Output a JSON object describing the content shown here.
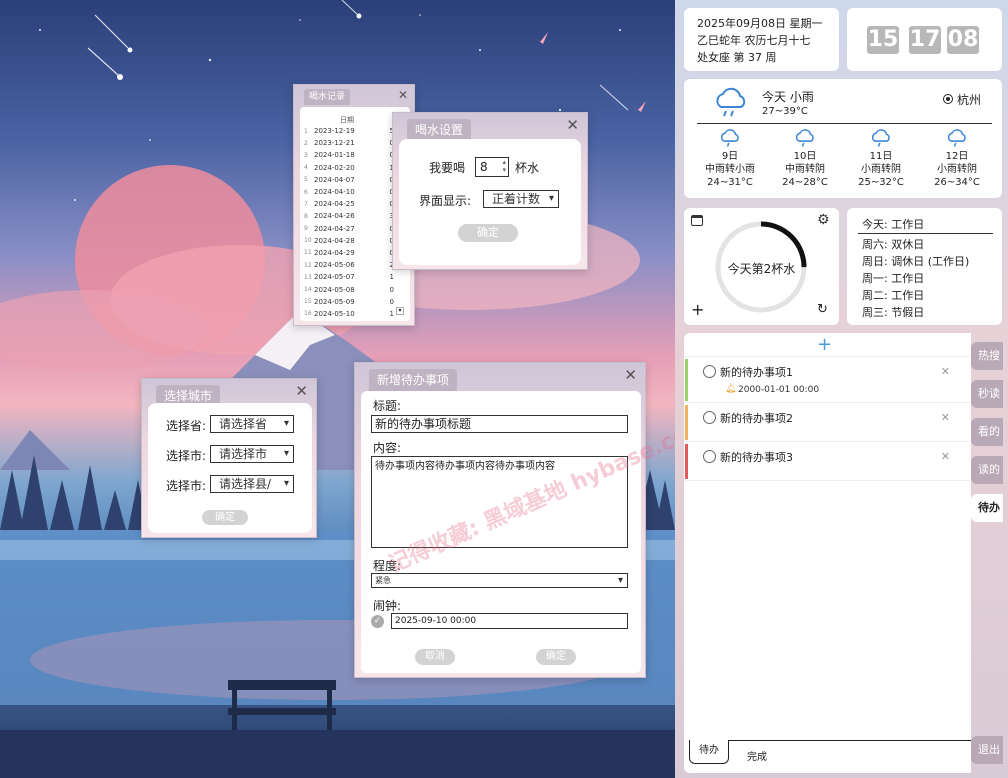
{
  "colors": {
    "accent_green": "#9bd06b",
    "accent_orange": "#f2b266",
    "accent_red": "#e05a5a",
    "plus_blue": "#3d9be9",
    "title_tab": "#bfb2c2"
  },
  "water_record": {
    "title": "喝水记录",
    "header": "日期",
    "rows": [
      {
        "idx": "1",
        "date": "2023-12-19",
        "val": "5"
      },
      {
        "idx": "2",
        "date": "2023-12-21",
        "val": "0"
      },
      {
        "idx": "3",
        "date": "2024-01-18",
        "val": "0"
      },
      {
        "idx": "4",
        "date": "2024-02-20",
        "val": "1"
      },
      {
        "idx": "5",
        "date": "2024-04-07",
        "val": "0"
      },
      {
        "idx": "6",
        "date": "2024-04-10",
        "val": "0"
      },
      {
        "idx": "7",
        "date": "2024-04-25",
        "val": "0"
      },
      {
        "idx": "8",
        "date": "2024-04-26",
        "val": "3"
      },
      {
        "idx": "9",
        "date": "2024-04-27",
        "val": "0"
      },
      {
        "idx": "10",
        "date": "2024-04-28",
        "val": "0"
      },
      {
        "idx": "11",
        "date": "2024-04-29",
        "val": "0"
      },
      {
        "idx": "12",
        "date": "2024-05-06",
        "val": "2"
      },
      {
        "idx": "13",
        "date": "2024-05-07",
        "val": "1"
      },
      {
        "idx": "14",
        "date": "2024-05-08",
        "val": "0"
      },
      {
        "idx": "15",
        "date": "2024-05-09",
        "val": "0"
      },
      {
        "idx": "16",
        "date": "2024-05-10",
        "val": "1"
      }
    ]
  },
  "water_settings": {
    "title": "喝水设置",
    "want_label": "我要喝",
    "cups_value": "8",
    "cups_unit": "杯水",
    "display_label": "界面显示:",
    "display_value": "正着计数",
    "ok": "确定"
  },
  "city": {
    "title": "选择城市",
    "province_label": "选择省:",
    "province_value": "请选择省",
    "city_label": "选择市:",
    "city_value": "请选择市",
    "county_label": "选择市:",
    "county_value": "请选择县/",
    "ok": "确定"
  },
  "new_todo": {
    "title": "新增待办事项",
    "title_label": "标题:",
    "title_value": "新的待办事项标题",
    "content_label": "内容:",
    "content_value": "待办事项内容待办事项内容待办事项内容",
    "level_label": "程度:",
    "level_value": "紧急",
    "alarm_label": "闹钟:",
    "alarm_value": "2025-09-10 00:00",
    "cancel": "取消",
    "ok": "确定"
  },
  "date_card": {
    "line1": "2025年09月08日  星期一",
    "line2": "乙巳蛇年  农历七月十七",
    "line3": "处女座  第 37 周"
  },
  "clock": {
    "h": "15",
    "m": "17",
    "s": "08"
  },
  "weather": {
    "today": "今天 小雨",
    "today_temp": "27~39°C",
    "city": "杭州",
    "forecast": [
      {
        "day": "9日",
        "desc": "中雨转小雨",
        "temp": "24~31°C"
      },
      {
        "day": "10日",
        "desc": "中雨转阴",
        "temp": "24~28°C"
      },
      {
        "day": "11日",
        "desc": "小雨转阴",
        "temp": "25~32°C"
      },
      {
        "day": "12日",
        "desc": "小雨转阴",
        "temp": "26~34°C"
      }
    ]
  },
  "water_widget": {
    "text": "今天第2杯水",
    "progress": 0.25
  },
  "workday": {
    "today": "今天:  工作日",
    "days": [
      "周六:  双休日",
      "周日:  调休日  (工作日)",
      "周一:  工作日",
      "周二:  工作日",
      "周三:  节假日"
    ]
  },
  "todos": [
    {
      "text": "新的待办事项1",
      "alarm": "2000-01-01 00:00"
    },
    {
      "text": "新的待办事项2"
    },
    {
      "text": "新的待办事项3"
    }
  ],
  "side_tabs": [
    "热搜",
    "秒读",
    "看的",
    "读的",
    "待办",
    "退出"
  ],
  "bottom_tabs": [
    "待办",
    "完成"
  ],
  "watermark": "记得收藏: 黑域基地 hybase.com"
}
